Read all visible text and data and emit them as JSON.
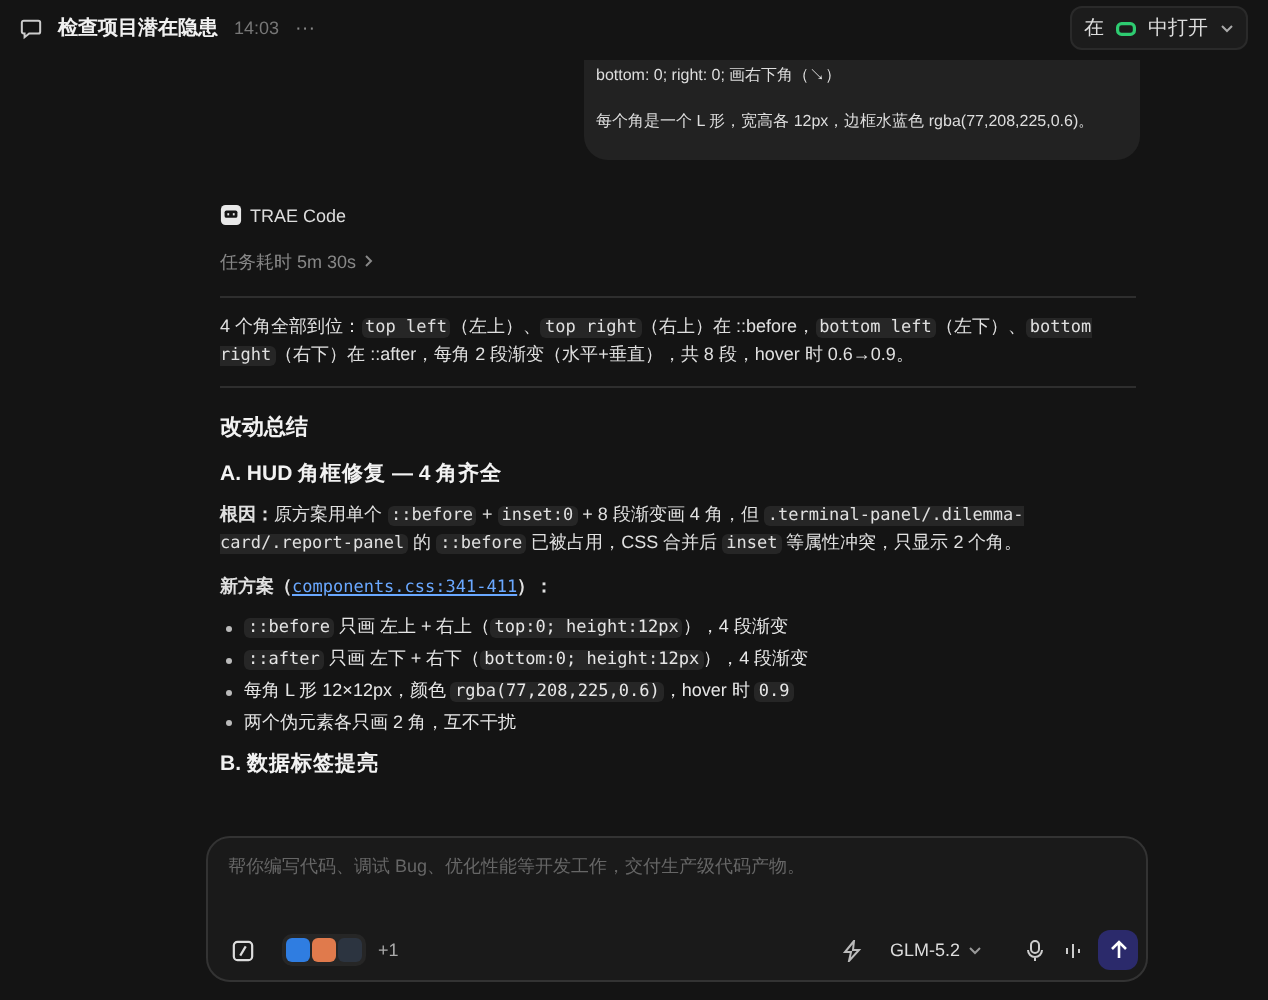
{
  "header": {
    "title": "检查项目潜在隐患",
    "time": "14:03",
    "more": "···",
    "open_in": {
      "prefix": "在",
      "label": "中打开"
    }
  },
  "user_message": {
    "lines": [
      "bottom: 0; right: 0; 画右下角（↘）",
      "每个角是一个 L 形，宽高各 12px，边框水蓝色 rgba(77,208,225,0.6)。"
    ]
  },
  "assistant": {
    "name": "TRAE Code",
    "task_time": "任务耗时 5m 30s",
    "blocks": [
      {
        "kind": "para",
        "parts": [
          {
            "kind": "text",
            "text": "4 个角全部到位："
          },
          {
            "kind": "code",
            "text": "top left"
          },
          {
            "kind": "text",
            "text": "（左上）、"
          },
          {
            "kind": "code",
            "text": "top right"
          },
          {
            "kind": "text",
            "text": "（右上）在 ::before，"
          },
          {
            "kind": "code",
            "text": "bottom left"
          },
          {
            "kind": "text",
            "text": "（左下）、"
          },
          {
            "kind": "code",
            "text": "bottom right"
          },
          {
            "kind": "text",
            "text": "（右下）在 ::after，每角 2 段渐变（水平+垂直），共 8 段，hover 时 0.6→0.9。"
          }
        ]
      },
      {
        "kind": "rule"
      },
      {
        "kind": "h2",
        "text": "改动总结"
      },
      {
        "kind": "h3",
        "text": "A. HUD 角框修复 — 4 角齐全"
      },
      {
        "kind": "para",
        "parts": [
          {
            "kind": "bold",
            "text": "根因："
          },
          {
            "kind": "text",
            "text": "原方案用单个 "
          },
          {
            "kind": "code",
            "text": "::before"
          },
          {
            "kind": "text",
            "text": " + "
          },
          {
            "kind": "code",
            "text": "inset:0"
          },
          {
            "kind": "text",
            "text": " + 8 段渐变画 4 角，但 "
          },
          {
            "kind": "code",
            "text": ".terminal-panel/.dilemma-card/.report-panel"
          },
          {
            "kind": "text",
            "text": " 的 "
          },
          {
            "kind": "code",
            "text": "::before"
          },
          {
            "kind": "text",
            "text": " 已被占用，CSS 合并后 "
          },
          {
            "kind": "code",
            "text": "inset"
          },
          {
            "kind": "text",
            "text": " 等属性冲突，只显示 2 个角。"
          }
        ]
      },
      {
        "kind": "para",
        "parts": [
          {
            "kind": "bold",
            "text": "新方案（"
          },
          {
            "kind": "link",
            "text": "components.css:341-411"
          },
          {
            "kind": "bold",
            "text": "）："
          }
        ]
      },
      {
        "kind": "bullets",
        "items": [
          [
            {
              "kind": "code",
              "text": "::before"
            },
            {
              "kind": "text",
              "text": " 只画 左上 + 右上（"
            },
            {
              "kind": "code",
              "text": "top:0; height:12px"
            },
            {
              "kind": "text",
              "text": "），4 段渐变"
            }
          ],
          [
            {
              "kind": "code",
              "text": "::after"
            },
            {
              "kind": "text",
              "text": " 只画 左下 + 右下（"
            },
            {
              "kind": "code",
              "text": "bottom:0; height:12px"
            },
            {
              "kind": "text",
              "text": "），4 段渐变"
            }
          ],
          [
            {
              "kind": "text",
              "text": "每角 L 形 12×12px，颜色 "
            },
            {
              "kind": "code",
              "text": "rgba(77,208,225,0.6)"
            },
            {
              "kind": "text",
              "text": "，hover 时 "
            },
            {
              "kind": "code",
              "text": "0.9"
            }
          ],
          [
            {
              "kind": "text",
              "text": "两个伪元素各只画 2 角，互不干扰"
            }
          ]
        ]
      },
      {
        "kind": "h3",
        "text": "B. 数据标签提亮"
      }
    ]
  },
  "composer": {
    "placeholder": "帮你编写代码、调试 Bug、优化性能等开发工作，交付生产级代码产物。",
    "extra_count": "+1",
    "model": "GLM-5.2"
  }
}
